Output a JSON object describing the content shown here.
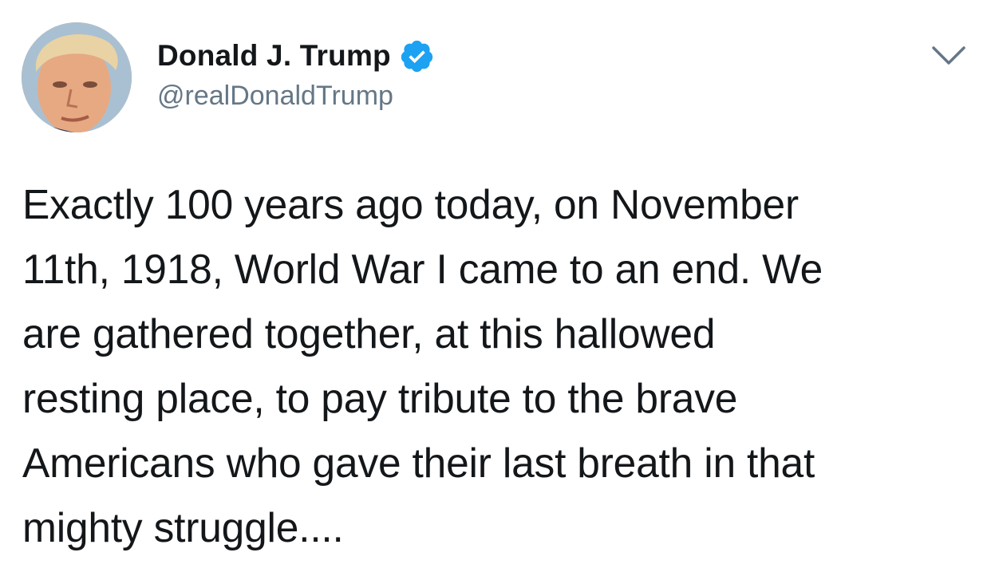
{
  "tweet": {
    "author": {
      "display_name": "Donald J. Trump",
      "handle": "@realDonaldTrump",
      "verified": true,
      "avatar_icon": "profile-photo"
    },
    "menu_icon": "chevron-down-icon",
    "text": "Exactly 100 years ago today, on November\n11th, 1918, World War I came to an end. We\nare gathered together, at this hallowed\nresting place, to pay tribute to the brave\nAmericans who gave their last breath in that\nmighty struggle...."
  },
  "colors": {
    "text_primary": "#14171a",
    "text_secondary": "#657786",
    "verified_blue": "#1da1f2",
    "chevron": "#657786"
  }
}
